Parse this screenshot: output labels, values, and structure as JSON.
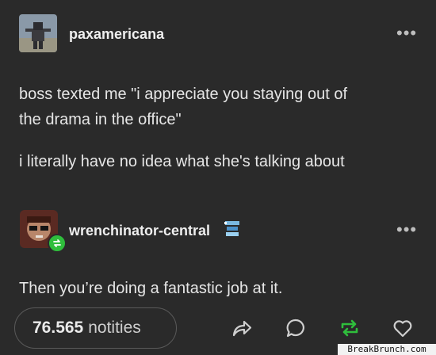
{
  "post": {
    "author": "paxamericana",
    "lines": [
      "boss texted me \"i appreciate you staying out of",
      "the drama in the office\"",
      "i literally have no idea what she's talking about"
    ]
  },
  "reblog": {
    "author": "wrenchinator-central",
    "text": "Then you’re doing a fantastic job at it."
  },
  "footer": {
    "notes_count": "76.565",
    "notes_label": "notities",
    "icons": [
      "share-icon",
      "reply-icon",
      "reblog-icon",
      "like-icon"
    ]
  },
  "watermark": "BreakBrunch.com",
  "colors": {
    "background": "#2a2a2a",
    "reblog_green": "#2fbe3c",
    "text": "#e6e6e6"
  }
}
